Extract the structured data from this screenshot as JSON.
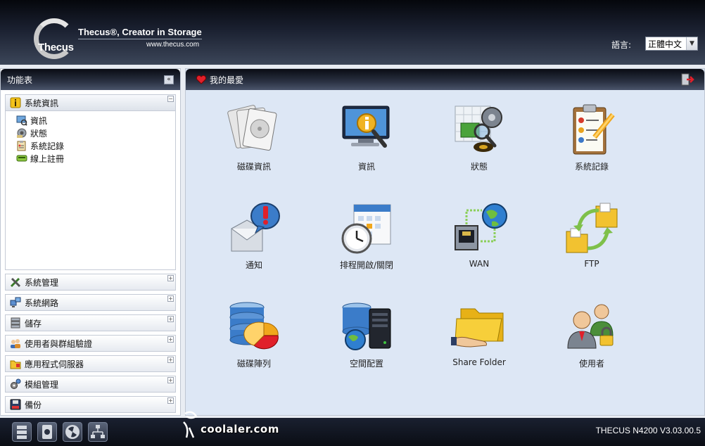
{
  "header": {
    "logo_text": "Thecus",
    "tagline": "Thecus®, Creator in Storage",
    "website": "www.thecus.com",
    "language_label": "語言:",
    "language_value": "正體中文"
  },
  "left_panel": {
    "title": "功能表",
    "categories": [
      {
        "label": "系統資訊",
        "icon": "info-icon",
        "expanded": true,
        "items": [
          {
            "label": "資訊",
            "icon": "monitor-info-icon"
          },
          {
            "label": "狀態",
            "icon": "status-icon"
          },
          {
            "label": "系統記錄",
            "icon": "log-icon"
          },
          {
            "label": "線上註冊",
            "icon": "register-icon"
          }
        ]
      },
      {
        "label": "系統管理",
        "icon": "tools-icon"
      },
      {
        "label": "系統網路",
        "icon": "network-icon"
      },
      {
        "label": "儲存",
        "icon": "storage-icon"
      },
      {
        "label": "使用者與群組驗證",
        "icon": "users-icon"
      },
      {
        "label": "應用程式伺服器",
        "icon": "app-server-icon"
      },
      {
        "label": "模組管理",
        "icon": "module-icon"
      },
      {
        "label": "備份",
        "icon": "backup-icon"
      }
    ]
  },
  "main_panel": {
    "title": "我的最愛",
    "apps": [
      {
        "label": "磁碟資訊",
        "icon": "disk-info-icon"
      },
      {
        "label": "資訊",
        "icon": "monitor-info-icon"
      },
      {
        "label": "狀態",
        "icon": "status-icon"
      },
      {
        "label": "系統記錄",
        "icon": "clipboard-log-icon"
      },
      {
        "label": "通知",
        "icon": "notification-icon"
      },
      {
        "label": "排程開啟/關閉",
        "icon": "schedule-icon"
      },
      {
        "label": "WAN",
        "icon": "wan-icon"
      },
      {
        "label": "FTP",
        "icon": "ftp-icon"
      },
      {
        "label": "磁碟陣列",
        "icon": "raid-icon"
      },
      {
        "label": "空間配置",
        "icon": "space-allocation-icon"
      },
      {
        "label": "Share Folder",
        "icon": "share-folder-icon"
      },
      {
        "label": "使用者",
        "icon": "user-icon"
      }
    ]
  },
  "footer": {
    "watermark": "coolaler.com",
    "version": "THECUS N4200 V3.03.00.5"
  }
}
